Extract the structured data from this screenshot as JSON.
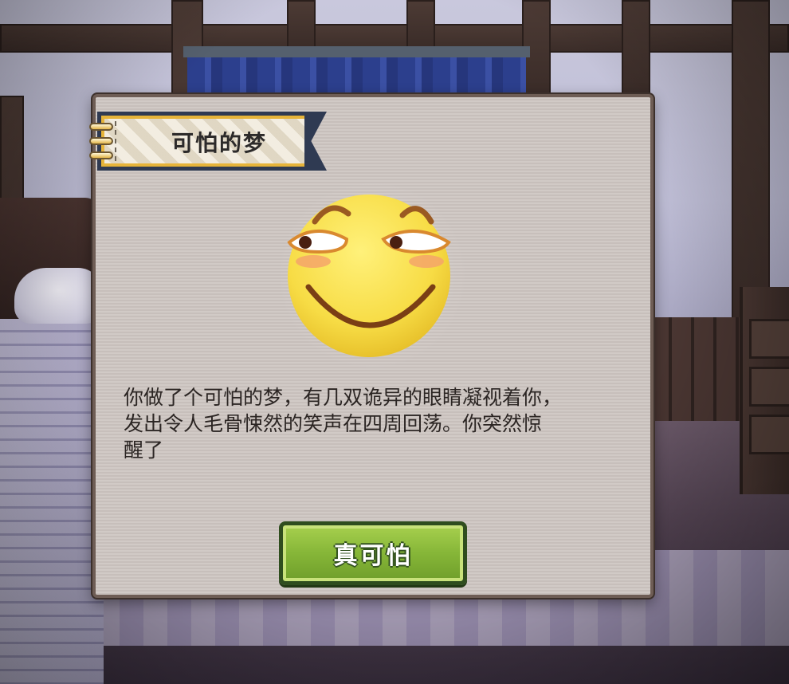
{
  "dialog": {
    "title": "可怕的梦",
    "message": "你做了个可怕的梦，有几双诡异的眼睛凝视着你，\n发出令人毛骨悚然的笑声在四周回荡。你突然惊\n醒了",
    "confirm_label": "真可怕",
    "icon": "sly-smile-emoji-icon"
  },
  "scene": {
    "setting": "bedroom-night"
  },
  "colors": {
    "dialog_bg": "#cec6c2",
    "dialog_border": "#6e5d55",
    "ribbon_border": "#2f3a52",
    "ribbon_accent": "#e6b43a",
    "button_green": "#86b638",
    "emoji_yellow": "#f7dc45"
  }
}
